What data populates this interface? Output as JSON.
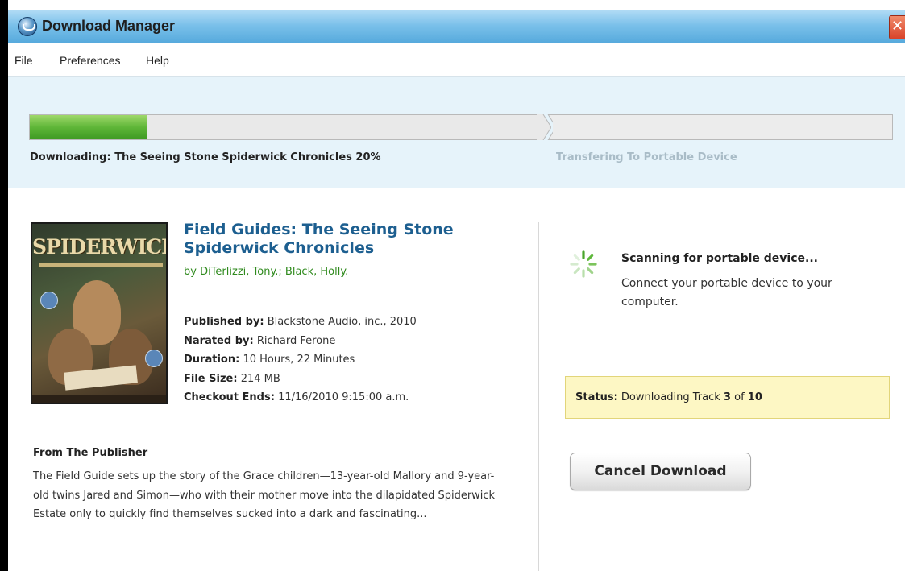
{
  "window": {
    "title": "Download Manager",
    "close_glyph": "✕"
  },
  "menu": {
    "items": [
      "File",
      "Preferences",
      "Help"
    ]
  },
  "progress": {
    "percent": 20,
    "stage1_label": "Downloading: The Seeing Stone Spiderwick Chronicles  20%",
    "stage2_label": "Transfering To Portable Device",
    "fill_color": "#5fb638"
  },
  "book": {
    "cover_text": "SPIDERWICK",
    "title": "Field Guides: The Seeing Stone Spiderwick Chronicles",
    "authors": "by DiTerlizzi, Tony.; Black, Holly.",
    "meta": [
      {
        "key": "Published by:",
        "value": "Blackstone Audio, inc., 2010"
      },
      {
        "key": "Narated by:",
        "value": "Richard Ferone"
      },
      {
        "key": "Duration:",
        "value": "10 Hours, 22 Minutes"
      },
      {
        "key": "File Size:",
        "value": "214 MB"
      },
      {
        "key": "Checkout Ends:",
        "value": "11/16/2010  9:15:00 a.m."
      }
    ]
  },
  "publisher": {
    "heading": "From The Publisher",
    "text": "The Field Guide sets up the story of the Grace children—13-year-old Mallory and 9-year-old twins Jared and Simon—who with their mother move into the dilapidated Spiderwick Estate only to quickly find themselves sucked into a dark and fascinating..."
  },
  "device": {
    "icon": "spinner-icon",
    "title": "Scanning for portable device...",
    "text": "Connect your portable device to your computer."
  },
  "status": {
    "label": "Status:",
    "prefix": "Downloading Track",
    "current": "3",
    "of": "of",
    "total": "10"
  },
  "actions": {
    "cancel_label": "Cancel Download"
  }
}
